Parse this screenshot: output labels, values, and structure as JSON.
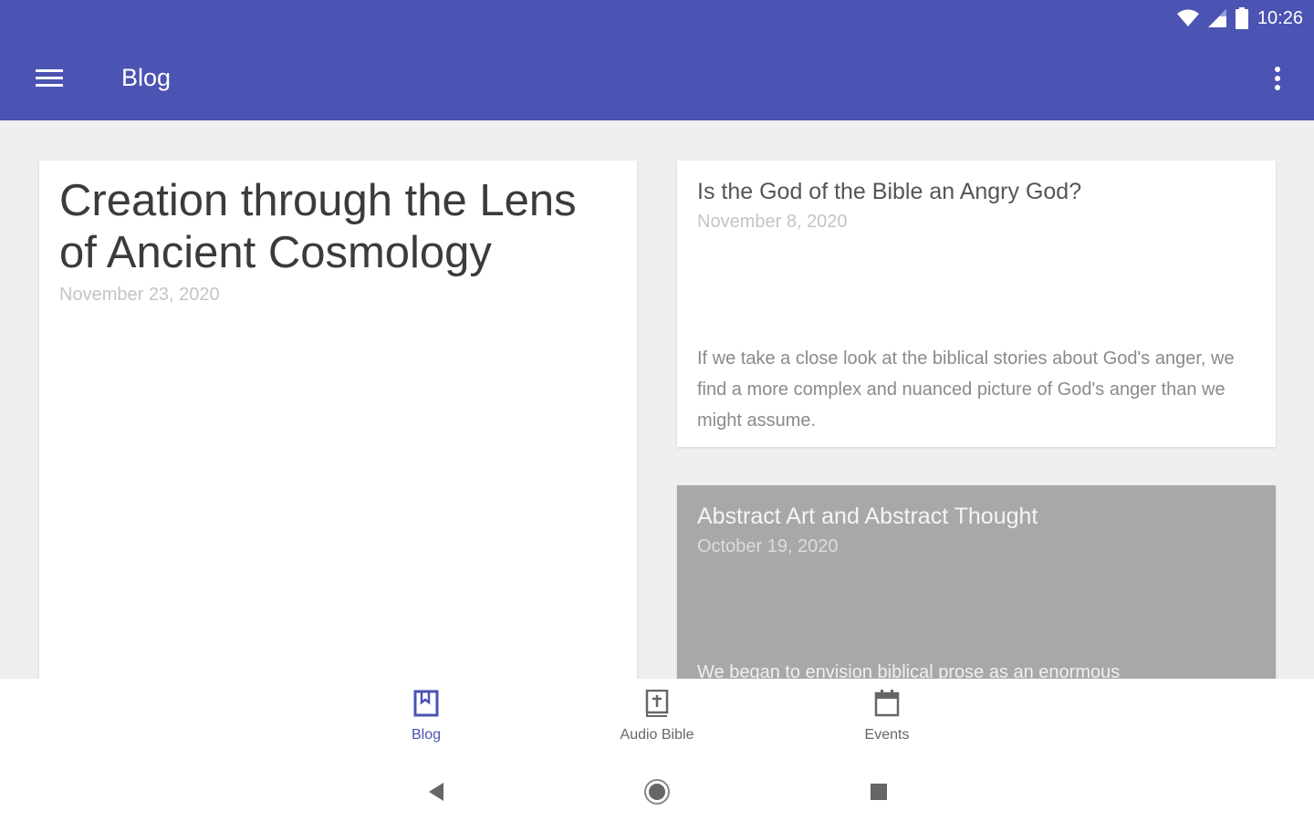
{
  "status_bar": {
    "time": "10:26",
    "icons": [
      "wifi-icon",
      "cellular-signal-icon",
      "battery-icon"
    ]
  },
  "app_bar": {
    "title": "Blog",
    "menu_icon": "hamburger-menu-icon",
    "overflow_icon": "more-vert-icon",
    "color": "#4b53b3"
  },
  "posts": [
    {
      "title": "Creation through the Lens of Ancient Cosmology",
      "date": "November 23, 2020",
      "excerpt": ""
    },
    {
      "title": "Is the God of the Bible an Angry God?",
      "date": "November 8, 2020",
      "excerpt": "If we take a close look at the biblical stories about God's anger, we find a more complex and nuanced picture of God's anger than we might assume."
    },
    {
      "title": "Abstract Art and Abstract Thought",
      "date": "October 19, 2020",
      "excerpt": "We began to envision biblical prose as an enormous"
    }
  ],
  "bottom_nav": {
    "items": [
      {
        "label": "Blog",
        "icon": "bookmark-book-icon",
        "active": true
      },
      {
        "label": "Audio Bible",
        "icon": "bible-icon",
        "active": false
      },
      {
        "label": "Events",
        "icon": "calendar-icon",
        "active": false
      }
    ],
    "active_color": "#4b53b3"
  },
  "system_nav": {
    "icons": [
      "back-icon",
      "home-icon",
      "recents-icon"
    ]
  }
}
